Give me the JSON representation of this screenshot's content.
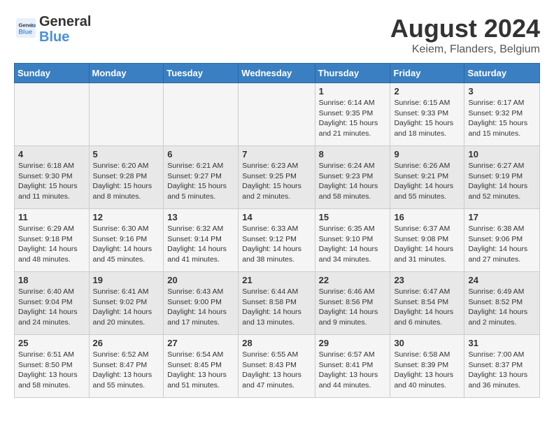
{
  "logo": {
    "line1": "General",
    "line2": "Blue"
  },
  "title": "August 2024",
  "subtitle": "Keiem, Flanders, Belgium",
  "weekdays": [
    "Sunday",
    "Monday",
    "Tuesday",
    "Wednesday",
    "Thursday",
    "Friday",
    "Saturday"
  ],
  "rows": [
    [
      {
        "day": "",
        "info": ""
      },
      {
        "day": "",
        "info": ""
      },
      {
        "day": "",
        "info": ""
      },
      {
        "day": "",
        "info": ""
      },
      {
        "day": "1",
        "info": "Sunrise: 6:14 AM\nSunset: 9:35 PM\nDaylight: 15 hours\nand 21 minutes."
      },
      {
        "day": "2",
        "info": "Sunrise: 6:15 AM\nSunset: 9:33 PM\nDaylight: 15 hours\nand 18 minutes."
      },
      {
        "day": "3",
        "info": "Sunrise: 6:17 AM\nSunset: 9:32 PM\nDaylight: 15 hours\nand 15 minutes."
      }
    ],
    [
      {
        "day": "4",
        "info": "Sunrise: 6:18 AM\nSunset: 9:30 PM\nDaylight: 15 hours\nand 11 minutes."
      },
      {
        "day": "5",
        "info": "Sunrise: 6:20 AM\nSunset: 9:28 PM\nDaylight: 15 hours\nand 8 minutes."
      },
      {
        "day": "6",
        "info": "Sunrise: 6:21 AM\nSunset: 9:27 PM\nDaylight: 15 hours\nand 5 minutes."
      },
      {
        "day": "7",
        "info": "Sunrise: 6:23 AM\nSunset: 9:25 PM\nDaylight: 15 hours\nand 2 minutes."
      },
      {
        "day": "8",
        "info": "Sunrise: 6:24 AM\nSunset: 9:23 PM\nDaylight: 14 hours\nand 58 minutes."
      },
      {
        "day": "9",
        "info": "Sunrise: 6:26 AM\nSunset: 9:21 PM\nDaylight: 14 hours\nand 55 minutes."
      },
      {
        "day": "10",
        "info": "Sunrise: 6:27 AM\nSunset: 9:19 PM\nDaylight: 14 hours\nand 52 minutes."
      }
    ],
    [
      {
        "day": "11",
        "info": "Sunrise: 6:29 AM\nSunset: 9:18 PM\nDaylight: 14 hours\nand 48 minutes."
      },
      {
        "day": "12",
        "info": "Sunrise: 6:30 AM\nSunset: 9:16 PM\nDaylight: 14 hours\nand 45 minutes."
      },
      {
        "day": "13",
        "info": "Sunrise: 6:32 AM\nSunset: 9:14 PM\nDaylight: 14 hours\nand 41 minutes."
      },
      {
        "day": "14",
        "info": "Sunrise: 6:33 AM\nSunset: 9:12 PM\nDaylight: 14 hours\nand 38 minutes."
      },
      {
        "day": "15",
        "info": "Sunrise: 6:35 AM\nSunset: 9:10 PM\nDaylight: 14 hours\nand 34 minutes."
      },
      {
        "day": "16",
        "info": "Sunrise: 6:37 AM\nSunset: 9:08 PM\nDaylight: 14 hours\nand 31 minutes."
      },
      {
        "day": "17",
        "info": "Sunrise: 6:38 AM\nSunset: 9:06 PM\nDaylight: 14 hours\nand 27 minutes."
      }
    ],
    [
      {
        "day": "18",
        "info": "Sunrise: 6:40 AM\nSunset: 9:04 PM\nDaylight: 14 hours\nand 24 minutes."
      },
      {
        "day": "19",
        "info": "Sunrise: 6:41 AM\nSunset: 9:02 PM\nDaylight: 14 hours\nand 20 minutes."
      },
      {
        "day": "20",
        "info": "Sunrise: 6:43 AM\nSunset: 9:00 PM\nDaylight: 14 hours\nand 17 minutes."
      },
      {
        "day": "21",
        "info": "Sunrise: 6:44 AM\nSunset: 8:58 PM\nDaylight: 14 hours\nand 13 minutes."
      },
      {
        "day": "22",
        "info": "Sunrise: 6:46 AM\nSunset: 8:56 PM\nDaylight: 14 hours\nand 9 minutes."
      },
      {
        "day": "23",
        "info": "Sunrise: 6:47 AM\nSunset: 8:54 PM\nDaylight: 14 hours\nand 6 minutes."
      },
      {
        "day": "24",
        "info": "Sunrise: 6:49 AM\nSunset: 8:52 PM\nDaylight: 14 hours\nand 2 minutes."
      }
    ],
    [
      {
        "day": "25",
        "info": "Sunrise: 6:51 AM\nSunset: 8:50 PM\nDaylight: 13 hours\nand 58 minutes."
      },
      {
        "day": "26",
        "info": "Sunrise: 6:52 AM\nSunset: 8:47 PM\nDaylight: 13 hours\nand 55 minutes."
      },
      {
        "day": "27",
        "info": "Sunrise: 6:54 AM\nSunset: 8:45 PM\nDaylight: 13 hours\nand 51 minutes."
      },
      {
        "day": "28",
        "info": "Sunrise: 6:55 AM\nSunset: 8:43 PM\nDaylight: 13 hours\nand 47 minutes."
      },
      {
        "day": "29",
        "info": "Sunrise: 6:57 AM\nSunset: 8:41 PM\nDaylight: 13 hours\nand 44 minutes."
      },
      {
        "day": "30",
        "info": "Sunrise: 6:58 AM\nSunset: 8:39 PM\nDaylight: 13 hours\nand 40 minutes."
      },
      {
        "day": "31",
        "info": "Sunrise: 7:00 AM\nSunset: 8:37 PM\nDaylight: 13 hours\nand 36 minutes."
      }
    ]
  ]
}
